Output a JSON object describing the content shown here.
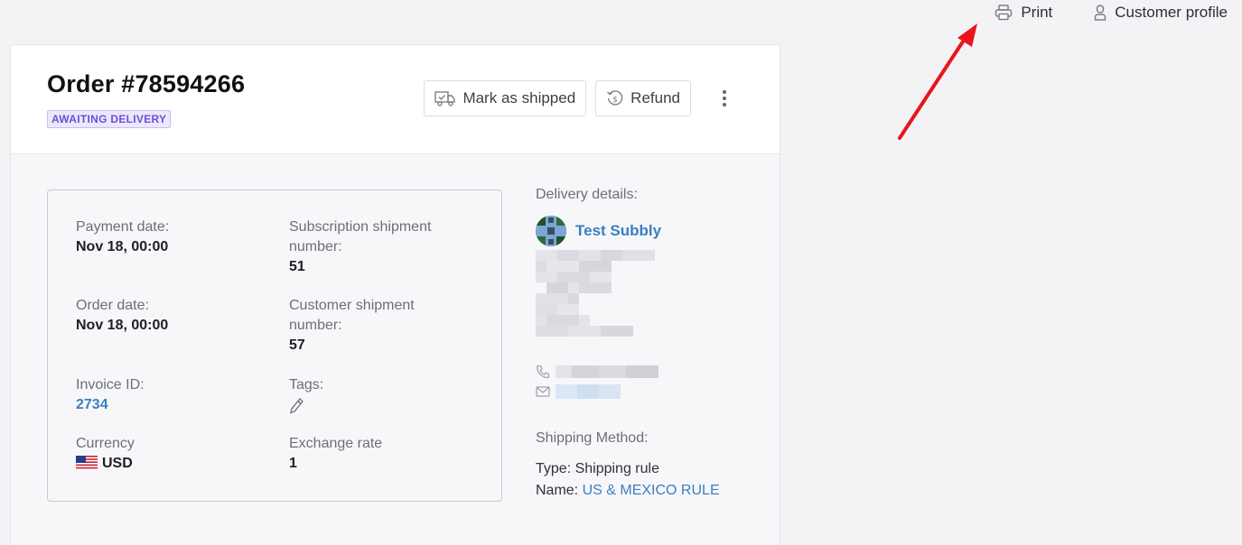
{
  "top_actions": {
    "print_label": "Print",
    "customer_profile_label": "Customer profile"
  },
  "order": {
    "title": "Order #78594266",
    "status": "AWAITING DELIVERY",
    "mark_shipped_label": "Mark as shipped",
    "refund_label": "Refund"
  },
  "details": {
    "payment_date_label": "Payment date:",
    "payment_date_value": "Nov 18, 00:00",
    "order_date_label": "Order date:",
    "order_date_value": "Nov 18, 00:00",
    "invoice_id_label": "Invoice ID:",
    "invoice_id_value": "2734",
    "currency_label": "Currency",
    "currency_value": "USD",
    "subscription_shipment_label_1": "Subscription shipment",
    "subscription_shipment_label_2": "number:",
    "subscription_shipment_value": "51",
    "customer_shipment_label_1": "Customer shipment",
    "customer_shipment_label_2": "number:",
    "customer_shipment_value": "57",
    "tags_label": "Tags:",
    "exchange_rate_label": "Exchange rate",
    "exchange_rate_value": "1"
  },
  "delivery": {
    "label": "Delivery details:",
    "customer_name": "Test Subbly",
    "shipping_method_label": "Shipping Method:",
    "type_line": "Type: Shipping rule",
    "name_prefix": "Name: ",
    "name_value": "US & MEXICO RULE"
  },
  "colors": {
    "accent_link": "#3a7fc1",
    "status_badge": "#6c4fd8",
    "annotation_arrow": "#e8161b"
  },
  "icons": [
    "printer-icon",
    "user-icon",
    "truck-icon",
    "refund-icon",
    "more-vertical-icon",
    "pencil-icon",
    "phone-icon",
    "mail-icon",
    "us-flag-icon"
  ]
}
